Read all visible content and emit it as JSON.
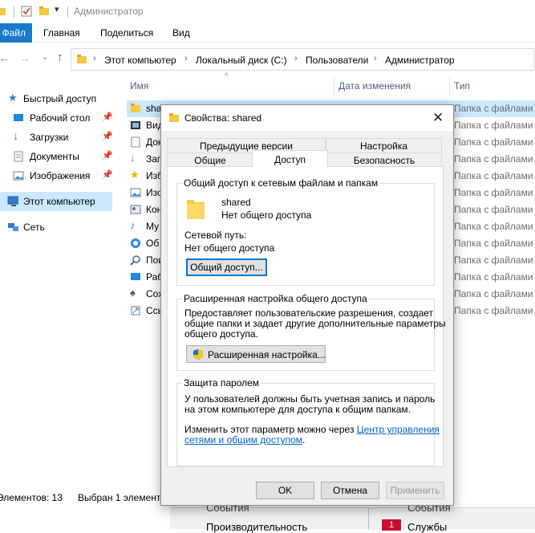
{
  "explorer": {
    "title": "Администратор",
    "ribbon_tabs": [
      "Файл",
      "Главная",
      "Поделиться",
      "Вид"
    ],
    "breadcrumb": [
      "Этот компьютер",
      "Локальный диск (C:)",
      "Пользователи",
      "Администратор"
    ],
    "nav": [
      {
        "label": "Быстрый доступ",
        "icon": "star-icon",
        "pinned": false
      },
      {
        "label": "Рабочий стол",
        "icon": "desktop-icon",
        "pinned": true
      },
      {
        "label": "Загрузки",
        "icon": "download-icon",
        "pinned": true
      },
      {
        "label": "Документы",
        "icon": "documents-icon",
        "pinned": true
      },
      {
        "label": "Изображения",
        "icon": "pictures-icon",
        "pinned": true
      },
      {
        "label": "Этот компьютер",
        "icon": "computer-icon",
        "pinned": false
      },
      {
        "label": "Сеть",
        "icon": "network-icon",
        "pinned": false
      }
    ],
    "columns": {
      "name": "Имя",
      "date": "Дата изменения",
      "type": "Тип"
    },
    "files": [
      {
        "name": "sha",
        "type": "Папка с файлами",
        "icon": "folder-icon"
      },
      {
        "name": "Вид",
        "type": "Папка с файлами",
        "icon": "video-icon"
      },
      {
        "name": "Док",
        "type": "Папка с файлами",
        "icon": "documents-icon"
      },
      {
        "name": "Заг",
        "type": "Папка с файлами",
        "icon": "download-icon"
      },
      {
        "name": "Изб",
        "type": "Папка с файлами",
        "icon": "star-icon"
      },
      {
        "name": "Изо",
        "type": "Папка с файлами",
        "icon": "pictures-icon"
      },
      {
        "name": "Кон",
        "type": "Папка с файлами",
        "icon": "contacts-icon"
      },
      {
        "name": "Му",
        "type": "Папка с файлами",
        "icon": "music-icon"
      },
      {
        "name": "Об",
        "type": "Папка с файлами",
        "icon": "onedrive-icon"
      },
      {
        "name": "Пои",
        "type": "Папка с файлами",
        "icon": "search-icon"
      },
      {
        "name": "Раб",
        "type": "Папка с файлами",
        "icon": "desktop-icon"
      },
      {
        "name": "Сох",
        "type": "Папка с файлами",
        "icon": "saved-games-icon"
      },
      {
        "name": "Ссь",
        "type": "Папка с файлами",
        "icon": "links-icon"
      }
    ],
    "status": {
      "count": "Элементов: 13",
      "selected": "Выбран 1 элемент"
    },
    "background_window": {
      "left_1": "События",
      "left_2": "Производительность",
      "right_1": "События",
      "right_2": "Службы",
      "badge": "1"
    }
  },
  "dialog": {
    "title": "Свойства: shared",
    "tabs_back": [
      "Предыдущие версии",
      "Настройка"
    ],
    "tabs_front": [
      "Общие",
      "Доступ",
      "Безопасность"
    ],
    "group_sharing": {
      "title": "Общий доступ к сетевым файлам и папкам",
      "folder_name": "shared",
      "folder_status": "Нет общего доступа",
      "path_label": "Сетевой путь:",
      "path_value": "Нет общего доступа",
      "button": "Общий доступ..."
    },
    "group_advanced": {
      "title": "Расширенная настройка общего доступа",
      "desc_1": "Предоставляет пользовательские разрешения, создает",
      "desc_2": "общие папки и задает другие дополнительные параметры",
      "desc_3": "общего доступа.",
      "button": "Расширенная настройка..."
    },
    "group_password": {
      "title": "Защита паролем",
      "desc_1": "У пользователей должны быть учетная запись и пароль",
      "desc_2": "на этом компьютере для доступа к общим папкам.",
      "change_prefix": "Изменить этот параметр можно через ",
      "link_1": "Центр управления",
      "link_2": "сетями и общим доступом",
      "suffix": "."
    },
    "buttons": {
      "ok": "OK",
      "cancel": "Отмена",
      "apply": "Применить"
    }
  },
  "colors": {
    "accent": "#1979ca",
    "selection": "#cce8ff",
    "folder": "#f6c846",
    "link": "#0066cc"
  }
}
